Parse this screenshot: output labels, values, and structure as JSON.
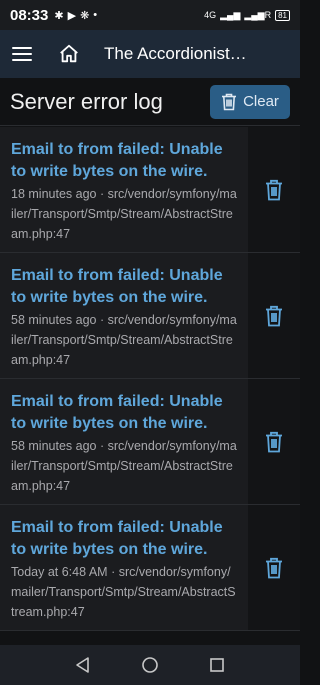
{
  "status_bar": {
    "time": "08:33",
    "network": "4G",
    "battery": "81"
  },
  "header": {
    "title": "The Accordionist…"
  },
  "page": {
    "title": "Server error log",
    "clear_label": "Clear"
  },
  "logs": [
    {
      "message": "Email to from failed: Unable to write bytes on the wire.",
      "time": "18 minutes ago",
      "source": "src/vendor/symfony/mailer/Transport/Smtp/Stream/AbstractStream.php:47"
    },
    {
      "message": "Email to from failed: Unable to write bytes on the wire.",
      "time": "58 minutes ago",
      "source": "src/vendor/symfony/mailer/Transport/Smtp/Stream/AbstractStream.php:47"
    },
    {
      "message": "Email to from failed: Unable to write bytes on the wire.",
      "time": "58 minutes ago",
      "source": "src/vendor/symfony/mailer/Transport/Smtp/Stream/AbstractStream.php:47"
    },
    {
      "message": "Email to from failed: Unable to write bytes on the wire.",
      "time": "Today at 6:48 AM",
      "source": "src/vendor/symfony/mailer/Transport/Smtp/Stream/AbstractStream.php:47"
    }
  ],
  "icons": {
    "menu": "menu-icon",
    "home": "home-icon",
    "trash": "trash-icon",
    "back": "back-icon",
    "home_nav": "circle-home-icon",
    "recents": "square-recents-icon"
  },
  "colors": {
    "accent": "#2a5d86",
    "link": "#5fa7db",
    "header": "#1e2937"
  }
}
